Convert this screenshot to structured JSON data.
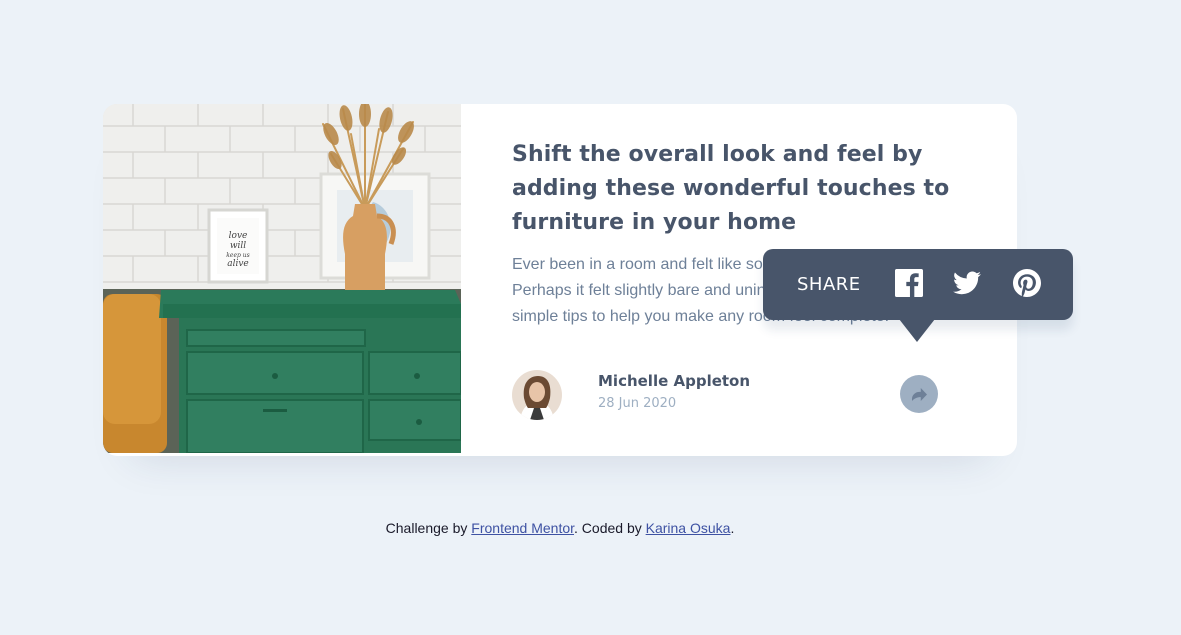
{
  "article": {
    "title": "Shift the overall look and feel by adding these wonderful touches to furniture in your home",
    "description": "Ever been in a room and felt like something was missing? Perhaps it felt slightly bare and uninviting. I’ve got some simple tips to help you make any room feel complete.",
    "image_alt": "Green drawers with a vase and framed pictures",
    "frame_text_1": "love",
    "frame_text_2": "will",
    "frame_text_3": "keep us",
    "frame_text_4": "alive"
  },
  "author": {
    "name": "Michelle Appleton",
    "date": "28 Jun 2020"
  },
  "share": {
    "label": "SHARE",
    "icons": [
      "share-arrow-icon",
      "facebook-icon",
      "twitter-icon",
      "pinterest-icon"
    ]
  },
  "footer": {
    "prefix": "Challenge by ",
    "link1": "Frontend Mentor",
    "middle": ". Coded by ",
    "link2": "Karina Osuka",
    "suffix": "."
  },
  "colors": {
    "background": "#ecf2f8",
    "card": "#ffffff",
    "heading": "#48556a",
    "body": "#6e8098",
    "muted": "#9eafc2",
    "tooltip": "#48556a",
    "link": "#3e52a3"
  }
}
